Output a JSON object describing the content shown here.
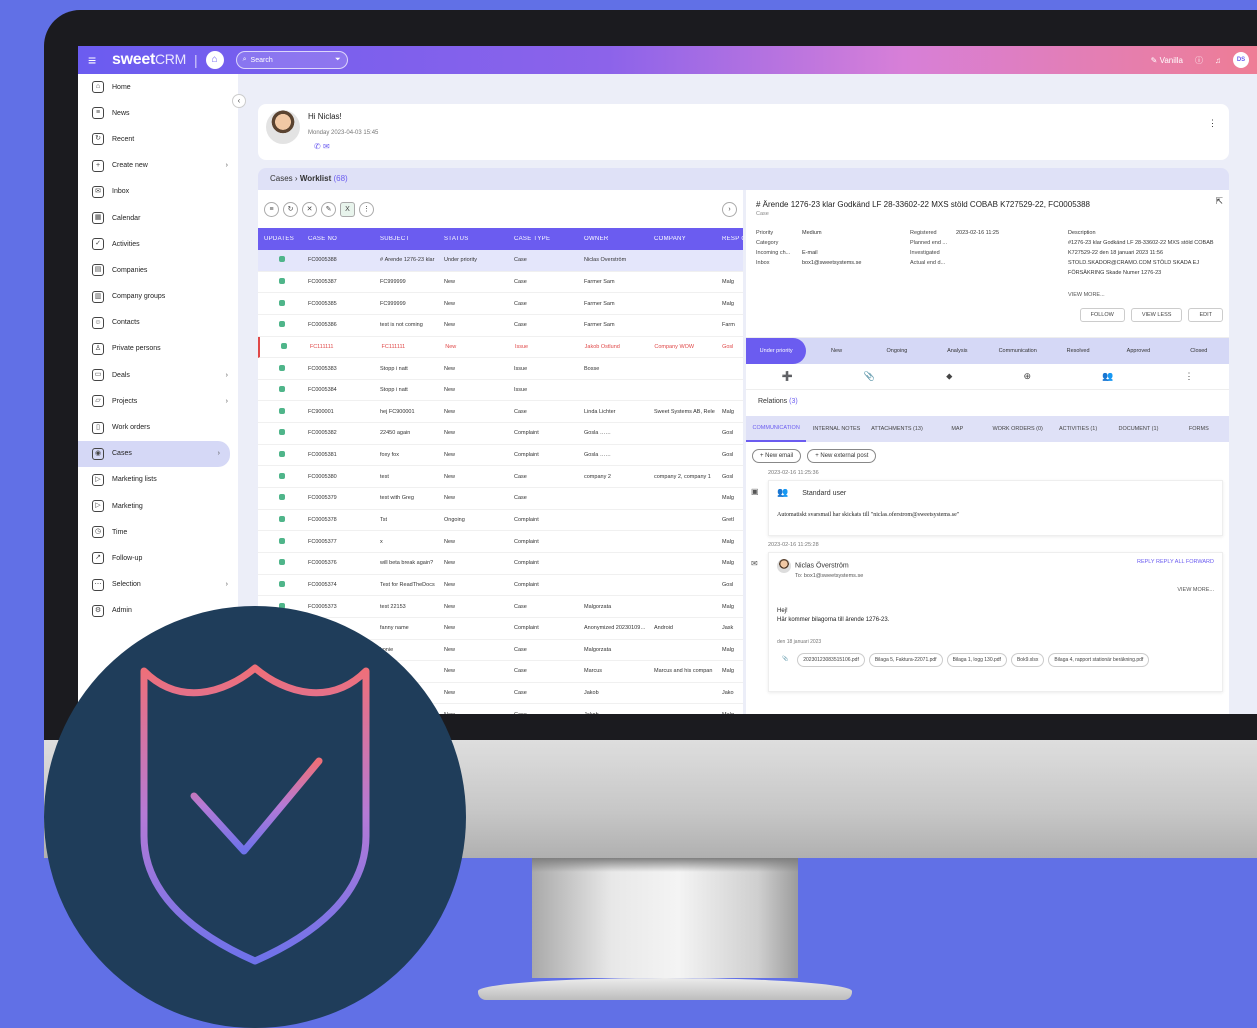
{
  "topbar": {
    "brand": "sweet",
    "brand_suffix": "CRM",
    "search_placeholder": "Search",
    "user_name": "Vanilla",
    "user_initials": "DS"
  },
  "sidebar": {
    "items": [
      {
        "label": "Home",
        "icon": "home-icon",
        "glyph": "⌂"
      },
      {
        "label": "News",
        "icon": "news-icon",
        "glyph": "≡"
      },
      {
        "label": "Recent",
        "icon": "recent-icon",
        "glyph": "↻"
      },
      {
        "label": "Create new",
        "icon": "plus-icon",
        "glyph": "+",
        "chevron": true
      },
      {
        "label": "Inbox",
        "icon": "mail-icon",
        "glyph": "✉"
      },
      {
        "label": "Calendar",
        "icon": "calendar-icon",
        "glyph": "▦"
      },
      {
        "label": "Activities",
        "icon": "activities-icon",
        "glyph": "✓"
      },
      {
        "label": "Companies",
        "icon": "companies-icon",
        "glyph": "▤"
      },
      {
        "label": "Company groups",
        "icon": "company-groups-icon",
        "glyph": "▥"
      },
      {
        "label": "Contacts",
        "icon": "contacts-icon",
        "glyph": "☺"
      },
      {
        "label": "Private persons",
        "icon": "person-icon",
        "glyph": "♙"
      },
      {
        "label": "Deals",
        "icon": "deals-icon",
        "glyph": "▭",
        "chevron": true
      },
      {
        "label": "Projects",
        "icon": "projects-icon",
        "glyph": "▱",
        "chevron": true
      },
      {
        "label": "Work orders",
        "icon": "work-orders-icon",
        "glyph": "▯"
      },
      {
        "label": "Cases",
        "icon": "cases-icon",
        "glyph": "◉",
        "chevron": true,
        "active": true
      },
      {
        "label": "Marketing lists",
        "icon": "marketing-lists-icon",
        "glyph": "▷"
      },
      {
        "label": "Marketing",
        "icon": "marketing-icon",
        "glyph": "▷"
      },
      {
        "label": "Time",
        "icon": "clock-icon",
        "glyph": "◷"
      },
      {
        "label": "Follow-up",
        "icon": "chart-icon",
        "glyph": "↗"
      },
      {
        "label": "Selection",
        "icon": "selection-icon",
        "glyph": "⋯",
        "chevron": true
      },
      {
        "label": "Admin",
        "icon": "gear-icon",
        "glyph": "⚙"
      }
    ]
  },
  "hello": {
    "greeting": "Hi Niclas!",
    "date": "Monday 2023-04-03 15:45"
  },
  "breadcrumb": {
    "root": "Cases",
    "sep": "›",
    "current": "Worklist",
    "count": "(68)"
  },
  "table": {
    "headers": [
      "UPDATES",
      "CASE NO",
      "SUBJECT",
      "STATUS",
      "CASE TYPE",
      "OWNER",
      "COMPANY",
      "RESP O"
    ],
    "rows": [
      {
        "no": "FC0005388",
        "subject": "# Ärende 1276-23 klar",
        "status": "Under priority",
        "type": "Case",
        "owner": "Niclas Överström",
        "company": "",
        "resp": "",
        "sel": true
      },
      {
        "no": "FC0005387",
        "subject": "FC999999",
        "status": "New",
        "type": "Case",
        "owner": "Farmer Sam",
        "company": "",
        "resp": "Malg"
      },
      {
        "no": "FC0005385",
        "subject": "FC999999",
        "status": "New",
        "type": "Case",
        "owner": "Farmer Sam",
        "company": "",
        "resp": "Malg"
      },
      {
        "no": "FC0005386",
        "subject": "test is not coming",
        "status": "New",
        "type": "Case",
        "owner": "Farmer Sam",
        "company": "",
        "resp": "Farm"
      },
      {
        "no": "FC111111",
        "subject": "FC111111",
        "status": "New",
        "type": "Issue",
        "owner": "Jakob Östlund",
        "company": "Company WOW",
        "resp": "Gosl",
        "red": true
      },
      {
        "no": "FC0005383",
        "subject": "Stopp i natt",
        "status": "New",
        "type": "Issue",
        "owner": "Bosse",
        "company": "",
        "resp": ""
      },
      {
        "no": "FC0005384",
        "subject": "Stopp i natt",
        "status": "New",
        "type": "Issue",
        "owner": "",
        "company": "",
        "resp": ""
      },
      {
        "no": "FC900001",
        "subject": "hej FC900001",
        "status": "New",
        "type": "Case",
        "owner": "Linda Lichter",
        "company": "Sweet Systems AB, Rele",
        "resp": "Malg"
      },
      {
        "no": "FC0005382",
        "subject": "22450 again",
        "status": "New",
        "type": "Complaint",
        "owner": "Gosla ……",
        "company": "",
        "resp": "Gosl"
      },
      {
        "no": "FC0005381",
        "subject": "foxy fox",
        "status": "New",
        "type": "Complaint",
        "owner": "Gosla ……",
        "company": "",
        "resp": "Gosl"
      },
      {
        "no": "FC0005380",
        "subject": "test",
        "status": "New",
        "type": "Case",
        "owner": "company 2",
        "company": "company 2, company 1",
        "resp": "Gosl"
      },
      {
        "no": "FC0005379",
        "subject": "test with Greg",
        "status": "New",
        "type": "Case",
        "owner": "",
        "company": "",
        "resp": "Malg"
      },
      {
        "no": "FC0005378",
        "subject": "Tst",
        "status": "Ongoing",
        "type": "Complaint",
        "owner": "",
        "company": "",
        "resp": "Gretl"
      },
      {
        "no": "FC0005377",
        "subject": "x",
        "status": "New",
        "type": "Complaint",
        "owner": "",
        "company": "",
        "resp": "Malg"
      },
      {
        "no": "FC0005376",
        "subject": "will beta break again?",
        "status": "New",
        "type": "Complaint",
        "owner": "",
        "company": "",
        "resp": "Malg"
      },
      {
        "no": "FC0005374",
        "subject": "Test for ReadTheDocs",
        "status": "New",
        "type": "Complaint",
        "owner": "",
        "company": "",
        "resp": "Gosl"
      },
      {
        "no": "FC0005373",
        "subject": "test 22153",
        "status": "New",
        "type": "Case",
        "owner": "Malgorzata",
        "company": "",
        "resp": "Malg"
      },
      {
        "no": "FC0005372",
        "subject": "fanny name",
        "status": "New",
        "type": "Complaint",
        "owner": "Anonymized 20230109…",
        "company": "Android",
        "resp": "Jask"
      },
      {
        "no": "FC0005371",
        "subject": "konie",
        "status": "New",
        "type": "Case",
        "owner": "Malgorzata",
        "company": "",
        "resp": "Malg"
      },
      {
        "no": "FC0005370",
        "subject": "",
        "status": "New",
        "type": "Case",
        "owner": "Marcus",
        "company": "Marcus and his compan",
        "resp": "Malg"
      },
      {
        "no": "FC0005369",
        "subject": "…gell",
        "status": "New",
        "type": "Case",
        "owner": "Jakob",
        "company": "",
        "resp": "Jako"
      },
      {
        "no": "FC0005368",
        "subject": "",
        "status": "New",
        "type": "Case",
        "owner": "Jakob",
        "company": "",
        "resp": "Malg"
      }
    ]
  },
  "detail": {
    "title": "# Ärende 1276-23 klar Godkänd LF 28-33602-22 MXS stöld COBAB K727529-22, FC0005388",
    "subtitle": "Case",
    "col1": [
      {
        "k": "Priority",
        "v": "Medium"
      },
      {
        "k": "Category",
        "v": ""
      },
      {
        "k": "Incoming ch...",
        "v": "E-mail"
      },
      {
        "k": "Inbox",
        "v": "box1@sweetsystems.se"
      }
    ],
    "col2": [
      {
        "k": "Registered",
        "v": "2023-02-16 11:25"
      },
      {
        "k": "Planned end ...",
        "v": ""
      },
      {
        "k": "Investigated",
        "v": ""
      },
      {
        "k": "Actual end d...",
        "v": ""
      }
    ],
    "desc_label": "Description",
    "desc": "#1276-23 klar Godkänd LF 28-33602-22 MXS stöld COBAB K727529-22 den 18 januari 2023 11:56 STOLD.SKADOR@CRAMO.COM STÖLD SKADA EJ FÖRSÄKRING Skade Numer 1276-23",
    "view_more": "VIEW MORE...",
    "buttons": [
      "FOLLOW",
      "VIEW LESS",
      "EDIT"
    ],
    "stages": [
      "Under priority",
      "New",
      "Ongoing",
      "Analysis",
      "Communication",
      "Resolved",
      "Approved",
      "Closed"
    ],
    "actions": [
      "➕",
      "📎",
      "⬥",
      "⊕",
      "👥",
      "⋮"
    ]
  },
  "relations": {
    "label": "Relations",
    "count": "(3)",
    "tabs": [
      "COMMUNICATION",
      "INTERNAL NOTES",
      "ATTACHMENTS (13)",
      "MAP",
      "WORK ORDERS (0)",
      "ACTIVITIES (1)",
      "DOCUMENT (1)",
      "FORMS"
    ],
    "new_email": "+ New email",
    "new_post": "+ New external post",
    "entry1": {
      "ts": "2023-02-16 11:25:36",
      "who": "Standard user",
      "text": "Automatiskt svarsmail har skickats till \"niclas.oferstrom@sweetsystems.se\""
    },
    "entry2": {
      "ts": "2023-02-16 11:25:28",
      "who": "Niclas Överström",
      "to": "To: box1@sweetsystems.se",
      "reply": "REPLY  REPLY ALL  FORWARD",
      "view_more": "VIEW MORE...",
      "line1": "Hej!",
      "line2": "Här kommer bilagorna till ärende 1276-23.",
      "den": "den 18 januari 2023",
      "attachments": [
        "20230123083515106.pdf",
        "Bilaga 5, Faktura-22071.pdf",
        "Bilaga 1, logg 130.pdf",
        "Bok9.xlsx",
        "Bilaga 4, rapport stationär beräkning.pdf"
      ]
    }
  },
  "colors": {
    "accent": "#6b5cf0",
    "page_bg": "#6170e6",
    "shield_bg": "#1f3d5a",
    "status_dot": "#4fb58a",
    "alert": "#e04848"
  }
}
